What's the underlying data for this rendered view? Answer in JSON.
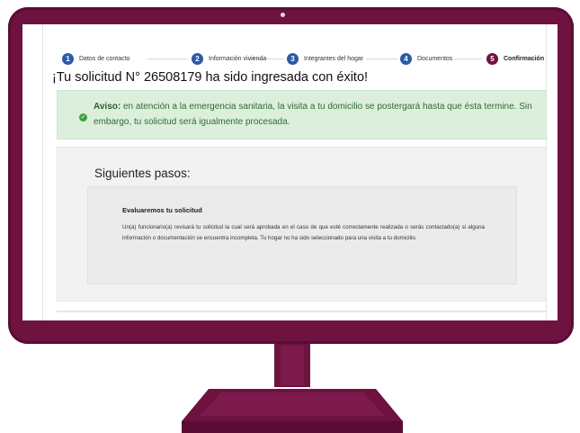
{
  "stepper": {
    "steps": [
      {
        "number": "1",
        "label": "Datos de contacto"
      },
      {
        "number": "2",
        "label": "Información vivienda"
      },
      {
        "number": "3",
        "label": "Integrantes del hogar"
      },
      {
        "number": "4",
        "label": "Documentos"
      },
      {
        "number": "5",
        "label": "Confirmación"
      }
    ],
    "active_step": 5
  },
  "title": "¡Tu solicitud N° 26508179 ha sido ingresada con éxito!",
  "alert": {
    "label": "Aviso:",
    "text": " en atención a la emergencia sanitaria, la visita a tu domicilio se postergará hasta que ésta termine. Sin embargo, tu solicitud será igualmente procesada.",
    "icon": "check-circle-icon"
  },
  "next_steps": {
    "heading": "Siguientes pasos:",
    "card": {
      "title": "Evaluaremos tu solicitud",
      "body": "Un(a) funcionario(a) revisará tu solicitud la cual será aprobada en el caso de que esté correctamente realizada o serás contactado(a) si alguna información o documentación se encuentra incompleta. Tu hogar no ha sido seleccionado para una visita a tu domicilio."
    }
  },
  "colors": {
    "monitor": "#6e1240",
    "step_blue": "#2b5aa8",
    "step_active": "#6e1240",
    "alert_bg": "#dcefdc",
    "alert_text": "#2f6b33"
  }
}
